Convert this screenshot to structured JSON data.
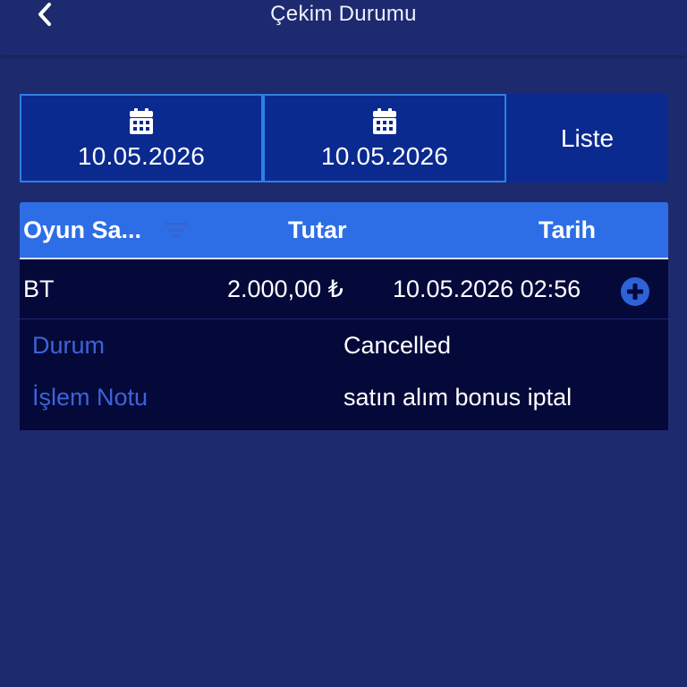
{
  "header": {
    "title": "Çekim Durumu",
    "back_icon": "chevron-left-icon"
  },
  "filters": {
    "start_date": "10.05.2026",
    "end_date": "10.05.2026",
    "list_label": "Liste",
    "calendar_icon": "calendar-icon"
  },
  "table": {
    "columns": [
      "Oyun Sa...",
      "Tutar",
      "Tarih"
    ],
    "rows": [
      {
        "game": "BT",
        "amount": "2.000,00 ₺",
        "date": "10.05.2026 02:56",
        "details": [
          {
            "label": "Durum",
            "value": "Cancelled"
          },
          {
            "label": "İşlem Notu",
            "value": "satın alım bonus iptal"
          }
        ]
      }
    ]
  },
  "colors": {
    "background": "#1e2a6e",
    "header": "#2d6ee6",
    "row": "#04093a",
    "label": "#3d63d8",
    "border": "#2f7fe6"
  }
}
